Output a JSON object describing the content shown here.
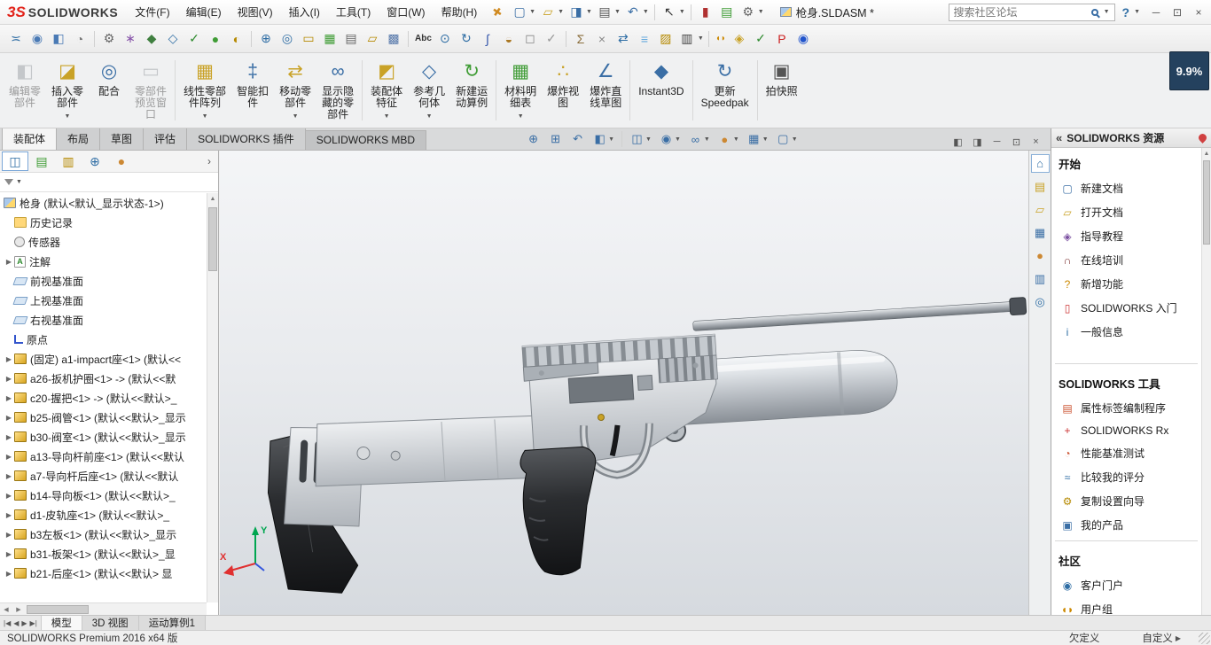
{
  "window": {
    "brand_mark": "3S",
    "brand_name": "SOLIDWORKS",
    "doc_title": "枪身.SLDASM *",
    "help_label": "?"
  },
  "menus": [
    "文件(F)",
    "编辑(E)",
    "视图(V)",
    "插入(I)",
    "工具(T)",
    "窗口(W)",
    "帮助(H)"
  ],
  "search": {
    "placeholder": "搜索社区论坛"
  },
  "app_window_icons": [
    {
      "name": "minimize-app",
      "glyph": "─"
    },
    {
      "name": "restore-app",
      "glyph": "⊡"
    },
    {
      "name": "close-app",
      "glyph": "×"
    }
  ],
  "quick_icons": [
    {
      "name": "new-document",
      "glyph": "▢",
      "color": "#3a6ea5",
      "caret": true
    },
    {
      "name": "open-document",
      "glyph": "▱",
      "color": "#c9a227",
      "caret": true
    },
    {
      "name": "save",
      "glyph": "◨",
      "color": "#3a6ea5",
      "caret": true
    },
    {
      "name": "print",
      "glyph": "▤",
      "color": "#555555",
      "caret": true
    },
    {
      "name": "undo",
      "glyph": "↶",
      "color": "#3a6ea5",
      "caret": true
    },
    {
      "sep": true
    },
    {
      "name": "select",
      "glyph": "↖",
      "color": "#333333",
      "caret": true
    },
    {
      "sep": true
    },
    {
      "name": "rebuild",
      "glyph": "▮",
      "color": "#b03030"
    },
    {
      "name": "file-properties",
      "glyph": "▤",
      "color": "#3f9c35"
    },
    {
      "name": "options",
      "glyph": "⚙",
      "color": "#666666",
      "caret": true
    }
  ],
  "tool_icons": [
    {
      "name": "measure",
      "glyph": "≍",
      "color": "#2e6da4"
    },
    {
      "name": "mass-properties",
      "glyph": "◉",
      "color": "#4a7ab5"
    },
    {
      "name": "section-properties",
      "glyph": "◧",
      "color": "#4a7ab5"
    },
    {
      "name": "performance-evaluation",
      "glyph": "◔",
      "color": "#777777"
    },
    {
      "sep": true
    },
    {
      "name": "options-tool",
      "glyph": "⚙",
      "color": "#666666"
    },
    {
      "name": "spray-gun",
      "glyph": "∗",
      "color": "#8855aa"
    },
    {
      "name": "defeature",
      "glyph": "◆",
      "color": "#3f7f3f"
    },
    {
      "name": "geometry-analysis",
      "glyph": "◇",
      "color": "#2e6da4"
    },
    {
      "name": "check-active-document",
      "glyph": "✓",
      "color": "#2d8a2d"
    },
    {
      "name": "curvature",
      "glyph": "●",
      "color": "#3f9c35"
    },
    {
      "name": "symmetry-check",
      "glyph": "◐",
      "color": "#b58900"
    },
    {
      "sep": true
    },
    {
      "name": "zoom-to-selection",
      "glyph": "⊕",
      "color": "#2e6da4"
    },
    {
      "name": "magnified-selection",
      "glyph": "◎",
      "color": "#2e6da4"
    },
    {
      "name": "comment",
      "glyph": "▭",
      "color": "#b58900"
    },
    {
      "name": "design-table",
      "glyph": "▦",
      "color": "#3f9c35"
    },
    {
      "name": "print-preview",
      "glyph": "▤",
      "color": "#666666"
    },
    {
      "name": "edit-markup",
      "glyph": "▱",
      "color": "#b58900"
    },
    {
      "name": "grid-system",
      "glyph": "▩",
      "color": "#5577aa"
    },
    {
      "sep": true
    },
    {
      "name": "spell-checker",
      "glyph": "Abc",
      "color": "#333333",
      "wide": true
    },
    {
      "name": "zoom-in-out",
      "glyph": "⊙",
      "color": "#2e6da4"
    },
    {
      "name": "reorient-sketch",
      "glyph": "↻",
      "color": "#2e6da4"
    },
    {
      "name": "curve-tool",
      "glyph": "∫",
      "color": "#3355aa"
    },
    {
      "name": "performance-gauge",
      "glyph": "◒",
      "color": "#aa7722"
    },
    {
      "name": "lock",
      "glyph": "◻",
      "color": "#888888"
    },
    {
      "name": "design-checker",
      "glyph": "✓",
      "color": "#999999"
    },
    {
      "sep": true
    },
    {
      "name": "equations",
      "glyph": "Σ",
      "color": "#8a6d3b"
    },
    {
      "name": "trim",
      "glyph": "×",
      "color": "#888888"
    },
    {
      "name": "translate",
      "glyph": "⇄",
      "color": "#2e6da4"
    },
    {
      "name": "freeze-bar",
      "glyph": "≡",
      "color": "#66aadd"
    },
    {
      "name": "property-wizard",
      "glyph": "▨",
      "color": "#b58900"
    },
    {
      "name": "display-states",
      "glyph": "▥",
      "color": "#444444",
      "caret": true
    },
    {
      "sep": true
    },
    {
      "name": "collaborate",
      "glyph": "◖◗",
      "color": "#cc8800",
      "wide": true
    },
    {
      "name": "toolbox",
      "glyph": "◈",
      "color": "#c9a227"
    },
    {
      "name": "verify",
      "glyph": "✓",
      "color": "#2d8a2d"
    },
    {
      "name": "save-as-pdf",
      "glyph": "P",
      "color": "#cc2222"
    },
    {
      "name": "edrawings",
      "glyph": "◉",
      "color": "#2255cc"
    }
  ],
  "ribbon": {
    "zoom_badge": "9.9%",
    "buttons": [
      {
        "name": "edit-component",
        "label": "编辑零\n部件",
        "glyph": "◧",
        "color": "#8a8f94",
        "disabled": true
      },
      {
        "name": "insert-components",
        "label": "插入零\n部件",
        "glyph": "◪",
        "color": "#c9a227",
        "caret": true
      },
      {
        "name": "mate",
        "label": "配合",
        "glyph": "◎",
        "color": "#3a6ea5"
      },
      {
        "name": "component-preview-window",
        "label": "零部件\n预览窗\n口",
        "glyph": "▭",
        "color": "#8a8f94",
        "disabled": true
      },
      {
        "sep": true
      },
      {
        "name": "linear-component-pattern",
        "label": "线性零部\n件阵列",
        "glyph": "▦",
        "color": "#c9a227",
        "caret": true
      },
      {
        "name": "smart-fasteners",
        "label": "智能扣\n件",
        "glyph": "‡",
        "color": "#3a6ea5"
      },
      {
        "name": "move-component",
        "label": "移动零\n部件",
        "glyph": "⇄",
        "color": "#c9a227",
        "caret": true
      },
      {
        "name": "show-hidden-components",
        "label": "显示隐\n藏的零\n部件",
        "glyph": "∞",
        "color": "#3a6ea5"
      },
      {
        "sep": true
      },
      {
        "name": "assembly-features",
        "label": "装配体\n特征",
        "glyph": "◩",
        "color": "#c9a227",
        "caret": true
      },
      {
        "name": "reference-geometry",
        "label": "参考几\n何体",
        "glyph": "◇",
        "color": "#3a6ea5",
        "caret": true
      },
      {
        "name": "new-motion-study",
        "label": "新建运\n动算例",
        "glyph": "↻",
        "color": "#3f9c35"
      },
      {
        "sep": true
      },
      {
        "name": "bill-of-materials",
        "label": "材料明\n细表",
        "glyph": "▦",
        "color": "#3f9c35",
        "caret": true
      },
      {
        "name": "exploded-view",
        "label": "爆炸视\n图",
        "glyph": "∴",
        "color": "#c9a227"
      },
      {
        "name": "explode-line-sketch",
        "label": "爆炸直\n线草图",
        "glyph": "∠",
        "color": "#3a6ea5"
      },
      {
        "sep": true
      },
      {
        "name": "instant3d",
        "label": "Instant3D",
        "glyph": "◆",
        "color": "#3a6ea5"
      },
      {
        "sep": true
      },
      {
        "name": "update-speedpak",
        "label": "更新\nSpeedpak",
        "glyph": "↻",
        "color": "#3a6ea5"
      },
      {
        "sep": true
      },
      {
        "name": "take-snapshot",
        "label": "拍快照",
        "glyph": "▣",
        "color": "#555555"
      }
    ]
  },
  "doc_tabs": [
    {
      "label": "装配体",
      "active": true
    },
    {
      "label": "布局"
    },
    {
      "label": "草图"
    },
    {
      "label": "评估"
    },
    {
      "label": "SOLIDWORKS 插件"
    },
    {
      "label": "SOLIDWORKS MBD",
      "dark": true
    }
  ],
  "view_icons": [
    {
      "name": "zoom-to-fit",
      "glyph": "⊕"
    },
    {
      "name": "zoom-to-area",
      "glyph": "⊞"
    },
    {
      "name": "previous-view",
      "glyph": "↶"
    },
    {
      "name": "section-view",
      "glyph": "◧",
      "caret": true
    },
    {
      "sep": true
    },
    {
      "name": "view-orientation",
      "glyph": "◫",
      "caret": true
    },
    {
      "name": "display-style",
      "glyph": "◉",
      "caret": true
    },
    {
      "name": "hide-show-items",
      "glyph": "∞",
      "caret": true
    },
    {
      "name": "edit-appearance",
      "glyph": "●",
      "color": "#cc8833",
      "caret": true
    },
    {
      "name": "apply-scene",
      "glyph": "▦",
      "caret": true
    },
    {
      "name": "view-settings",
      "glyph": "▢",
      "caret": true
    }
  ],
  "doc_window_icons": [
    {
      "name": "previous-window",
      "glyph": "◧"
    },
    {
      "name": "next-window",
      "glyph": "◨"
    },
    {
      "name": "minimize-document",
      "glyph": "─"
    },
    {
      "name": "restore-document",
      "glyph": "⊡"
    },
    {
      "name": "close-document",
      "glyph": "×"
    }
  ],
  "panel_tabs": [
    {
      "name": "featuremanager-tab",
      "glyph": "◫",
      "color": "#2e6da4",
      "active": true
    },
    {
      "name": "propertymanager-tab",
      "glyph": "▤",
      "color": "#3f9c35"
    },
    {
      "name": "configurationmanager-tab",
      "glyph": "▥",
      "color": "#b58900"
    },
    {
      "name": "dimxpertmanager-tab",
      "glyph": "⊕",
      "color": "#2e6da4"
    },
    {
      "name": "displaymanager-tab",
      "glyph": "●",
      "color": "#cc8833"
    }
  ],
  "feature_tree": {
    "items": [
      {
        "label": "枪身 (默认<默认_显示状态-1>)",
        "icon": "assembly",
        "root": true
      },
      {
        "label": "历史记录",
        "icon": "history"
      },
      {
        "label": "传感器",
        "icon": "sensors"
      },
      {
        "label": "注解",
        "icon": "annotations",
        "twist": true
      },
      {
        "label": "前视基准面",
        "icon": "plane"
      },
      {
        "label": "上视基准面",
        "icon": "plane"
      },
      {
        "label": "右视基准面",
        "icon": "plane"
      },
      {
        "label": "原点",
        "icon": "origin"
      },
      {
        "label": "(固定) a1-impacrt座<1> (默认<<",
        "icon": "part",
        "twist": true
      },
      {
        "label": "a26-扳机护圈<1> -> (默认<<默",
        "icon": "part",
        "twist": true
      },
      {
        "label": "c20-握把<1> -> (默认<<默认>_",
        "icon": "part",
        "twist": true
      },
      {
        "label": "b25-阀管<1> (默认<<默认>_显示",
        "icon": "part",
        "twist": true
      },
      {
        "label": "b30-阀室<1> (默认<<默认>_显示",
        "icon": "part",
        "twist": true
      },
      {
        "label": "a13-导向杆前座<1> (默认<<默认",
        "icon": "part",
        "twist": true
      },
      {
        "label": "a7-导向杆后座<1> (默认<<默认",
        "icon": "part",
        "twist": true
      },
      {
        "label": "b14-导向板<1> (默认<<默认>_",
        "icon": "part",
        "twist": true
      },
      {
        "label": "d1-皮轨座<1> (默认<<默认>_",
        "icon": "part",
        "twist": true
      },
      {
        "label": "b3左板<1> (默认<<默认>_显示",
        "icon": "part",
        "twist": true
      },
      {
        "label": "b31-板架<1> (默认<<默认>_显",
        "icon": "part",
        "twist": true
      },
      {
        "label": "b21-后座<1> (默认<<默认> 显",
        "icon": "part",
        "twist": true
      }
    ]
  },
  "strip_icons": [
    {
      "name": "solidworks-resources-tab",
      "glyph": "⌂",
      "color": "#2e6da4",
      "active": true
    },
    {
      "name": "design-library-tab",
      "glyph": "▤",
      "color": "#c9a227"
    },
    {
      "name": "file-explorer-tab",
      "glyph": "▱",
      "color": "#c9a227"
    },
    {
      "name": "view-palette-tab",
      "glyph": "▦",
      "color": "#3a6ea5"
    },
    {
      "name": "appearances-scenes-tab",
      "glyph": "●",
      "color": "#cc8833"
    },
    {
      "name": "custom-properties-tab",
      "glyph": "▥",
      "color": "#3a6ea5"
    },
    {
      "name": "solidworks-forum-tab",
      "glyph": "◎",
      "color": "#2e6da4"
    }
  ],
  "taskpane": {
    "collapse_glyph": "«",
    "title": "SOLIDWORKS 资源",
    "sections": [
      {
        "header": "开始",
        "items": [
          {
            "label": "新建文档",
            "icon_name": "new-document-icon",
            "glyph": "▢",
            "color": "#3a6ea5"
          },
          {
            "label": "打开文档",
            "icon_name": "open-document-icon",
            "glyph": "▱",
            "color": "#c9a227"
          },
          {
            "label": "指导教程",
            "icon_name": "tutorials-icon",
            "glyph": "◈",
            "color": "#7a4fa0"
          },
          {
            "label": "在线培训",
            "icon_name": "online-training-icon",
            "glyph": "∩",
            "color": "#7a2d2d"
          },
          {
            "label": "新增功能",
            "icon_name": "whats-new-icon",
            "glyph": "?",
            "color": "#cc8800"
          },
          {
            "label": "SOLIDWORKS 入门",
            "icon_name": "introducing-icon",
            "glyph": "▯",
            "color": "#cc3333"
          },
          {
            "label": "一般信息",
            "icon_name": "general-info-icon",
            "glyph": "i",
            "color": "#2e6da4"
          }
        ]
      },
      {
        "header": "SOLIDWORKS 工具",
        "items": [
          {
            "label": "属性标签编制程序",
            "icon_name": "property-tab-builder-icon",
            "glyph": "▤",
            "color": "#cc5533"
          },
          {
            "label": "SOLIDWORKS Rx",
            "icon_name": "solidworks-rx-icon",
            "glyph": "+",
            "color": "#cc3333"
          },
          {
            "label": "性能基准测试",
            "icon_name": "performance-benchmark-icon",
            "glyph": "◔",
            "color": "#cc5533"
          },
          {
            "label": "比较我的评分",
            "icon_name": "compare-score-icon",
            "glyph": "≈",
            "color": "#2e6da4"
          },
          {
            "label": "复制设置向导",
            "icon_name": "copy-settings-wizard-icon",
            "glyph": "⚙",
            "color": "#b58900"
          },
          {
            "label": "我的产品",
            "icon_name": "my-products-icon",
            "glyph": "▣",
            "color": "#3a6ea5"
          }
        ]
      },
      {
        "header": "社区",
        "items": [
          {
            "label": "客户门户",
            "icon_name": "customer-portal-icon",
            "glyph": "◉",
            "color": "#2e6da4"
          },
          {
            "label": "用户组",
            "icon_name": "user-groups-icon",
            "glyph": "◖◗",
            "color": "#cc8800"
          }
        ]
      }
    ]
  },
  "bottom": {
    "nav": [
      {
        "name": "tab-scroll-first",
        "glyph": "|◀"
      },
      {
        "name": "tab-scroll-prev",
        "glyph": "◀"
      },
      {
        "name": "tab-scroll-next",
        "glyph": "▶"
      },
      {
        "name": "tab-scroll-last",
        "glyph": "▶|"
      }
    ],
    "tabs": [
      {
        "label": "模型",
        "active": true
      },
      {
        "label": "3D 视图"
      },
      {
        "label": "运动算例1"
      }
    ]
  },
  "statusbar": {
    "left_text": "SOLIDWORKS Premium 2016 x64 版",
    "definition_state": "欠定义",
    "customize_label": "自定义"
  },
  "triad": {
    "x": "X",
    "y": "Y"
  }
}
